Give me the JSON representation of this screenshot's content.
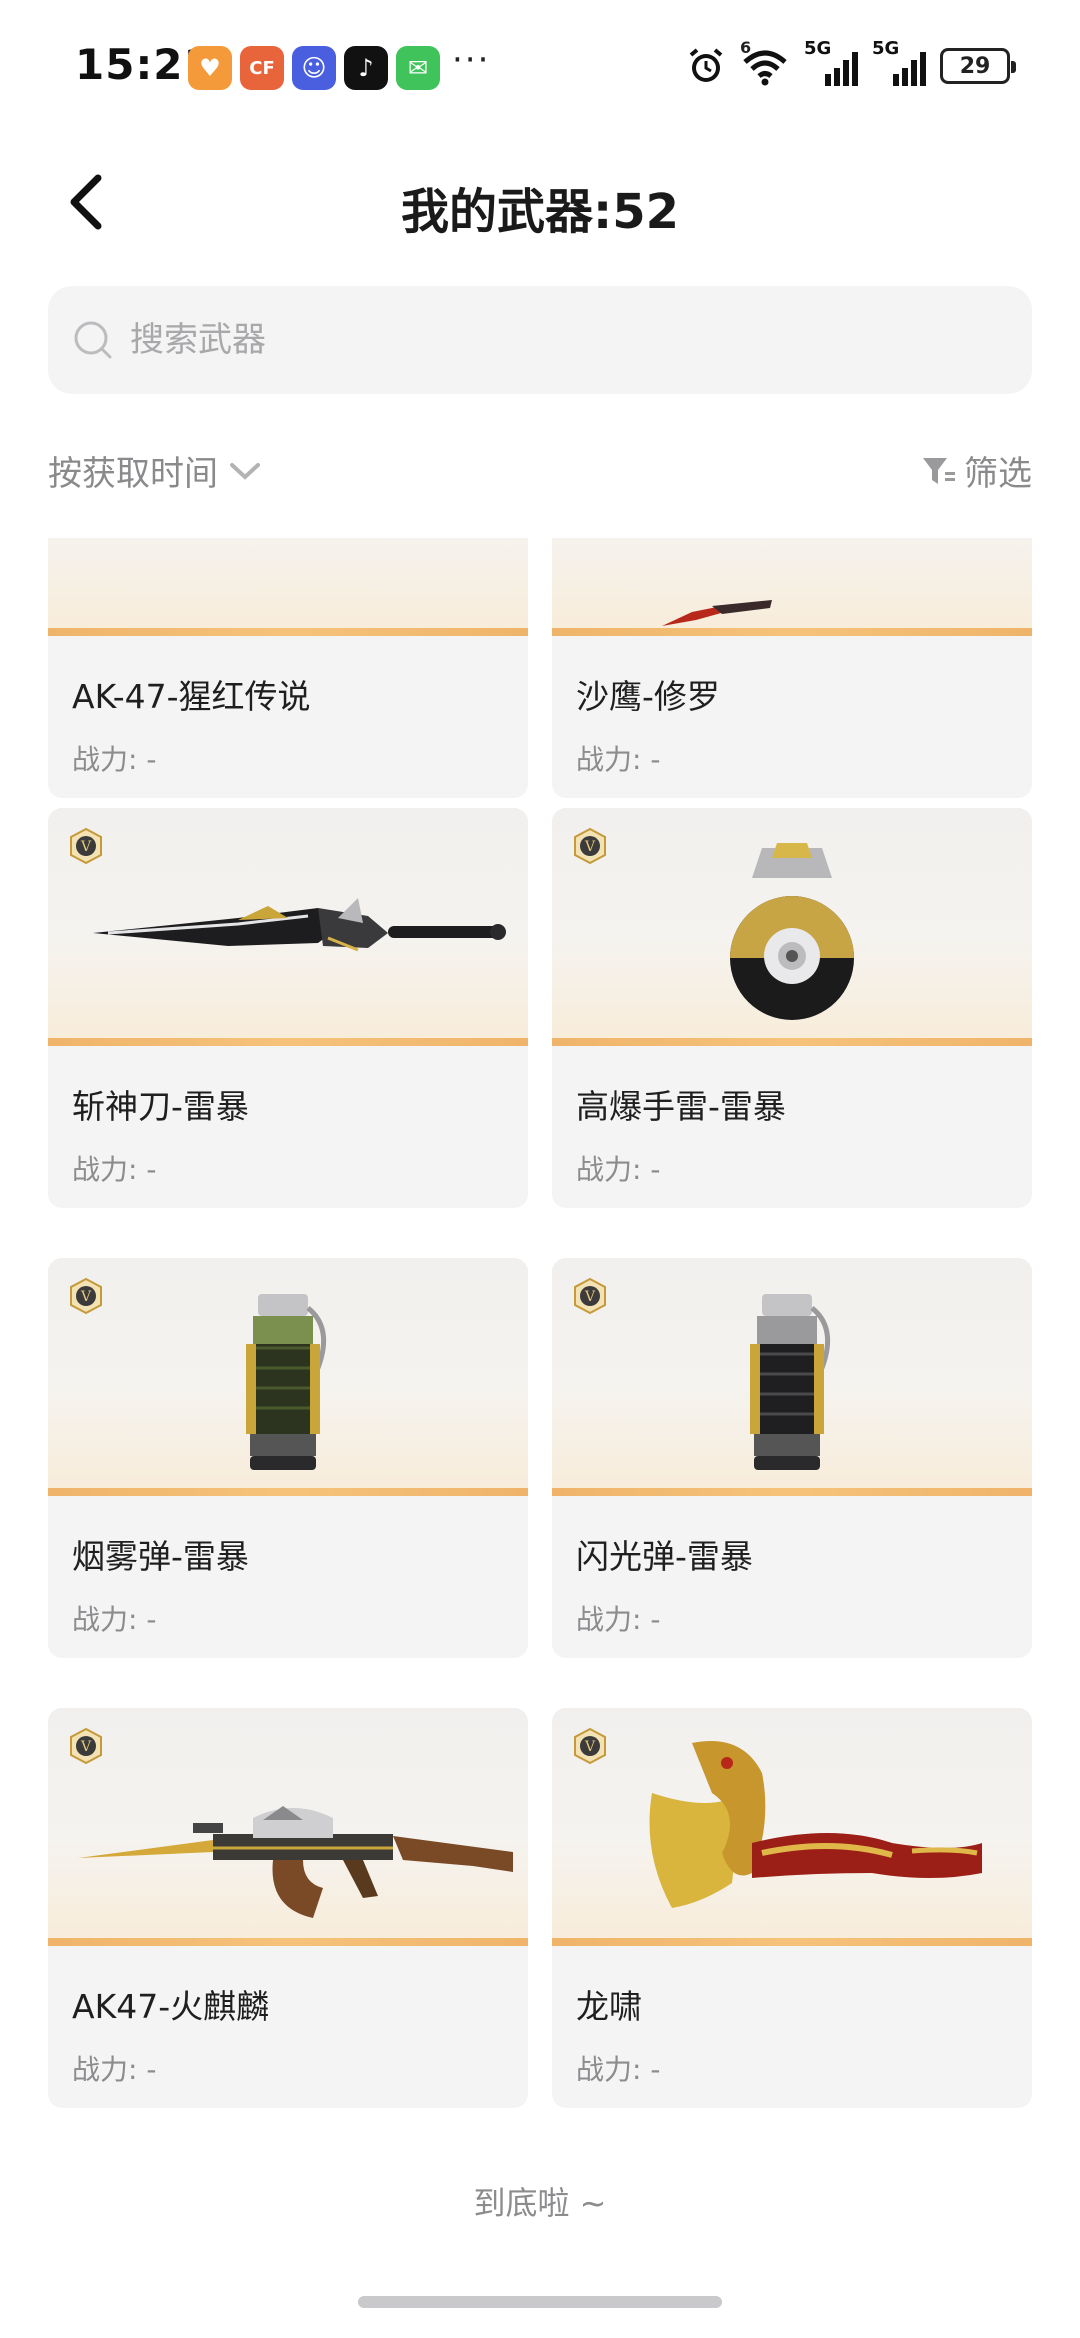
{
  "status_bar": {
    "time": "15:21",
    "more": "···",
    "battery": "29",
    "sig1": "5G",
    "sig2": "5G",
    "wifi_sup": "6"
  },
  "header": {
    "title": "我的武器:52"
  },
  "search": {
    "placeholder": "搜索武器"
  },
  "sort": {
    "label": "按获取时间"
  },
  "filter": {
    "label": "筛选"
  },
  "weapons": [
    {
      "name": "AK-47-猩红传说",
      "power": "战力: -"
    },
    {
      "name": "沙鹰-修罗",
      "power": "战力: -"
    },
    {
      "name": "斩神刀-雷暴",
      "power": "战力: -"
    },
    {
      "name": "高爆手雷-雷暴",
      "power": "战力: -"
    },
    {
      "name": "烟雾弹-雷暴",
      "power": "战力: -"
    },
    {
      "name": "闪光弹-雷暴",
      "power": "战力: -"
    },
    {
      "name": "AK47-火麒麟",
      "power": "战力: -"
    },
    {
      "name": "龙啸",
      "power": "战力: -"
    }
  ],
  "footer": {
    "text": "到底啦 ~"
  },
  "colors": {
    "accent_stripe": "#efb46a",
    "card_bg": "#f4f4f5",
    "muted_text": "#8c8c8e"
  }
}
